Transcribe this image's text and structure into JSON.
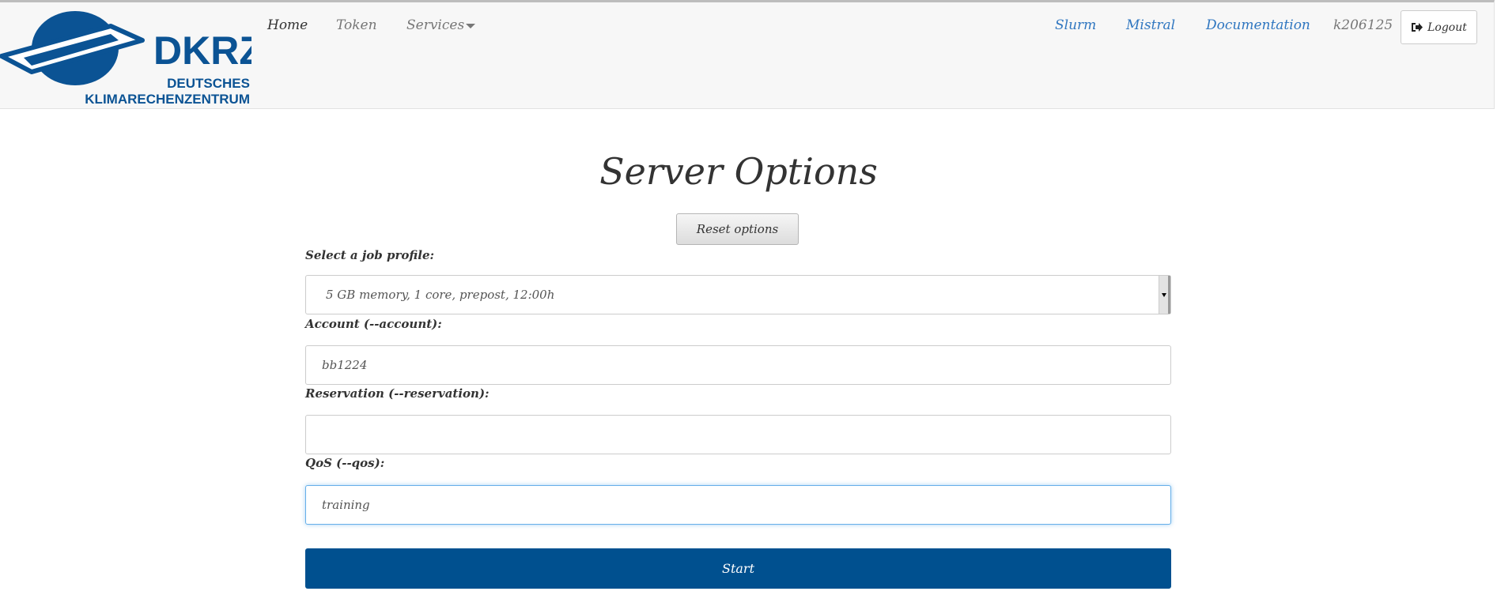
{
  "navbar": {
    "logo": {
      "text": "DKRZ",
      "subtitle_line1": "DEUTSCHES",
      "subtitle_line2": "KLIMARECHENZENTRUM",
      "color": "#0b5394"
    },
    "left_links": [
      {
        "label": "Home",
        "active": true
      },
      {
        "label": "Token"
      },
      {
        "label": "Services"
      }
    ],
    "right_links": [
      {
        "label": "Slurm"
      },
      {
        "label": "Mistral"
      },
      {
        "label": "Documentation"
      }
    ],
    "username": "k206125",
    "logout_label": "Logout"
  },
  "main": {
    "title": "Server Options",
    "reset_label": "Reset options",
    "job_profile": {
      "label": "Select a job profile:",
      "value": "5 GB memory, 1 core, prepost, 12:00h"
    },
    "account": {
      "label": "Account (--account):",
      "value": "bb1224"
    },
    "reservation": {
      "label": "Reservation (--reservation):",
      "value": ""
    },
    "qos": {
      "label": "QoS (--qos):",
      "value": "training"
    },
    "start_label": "Start",
    "accent_color": "#00508f"
  }
}
